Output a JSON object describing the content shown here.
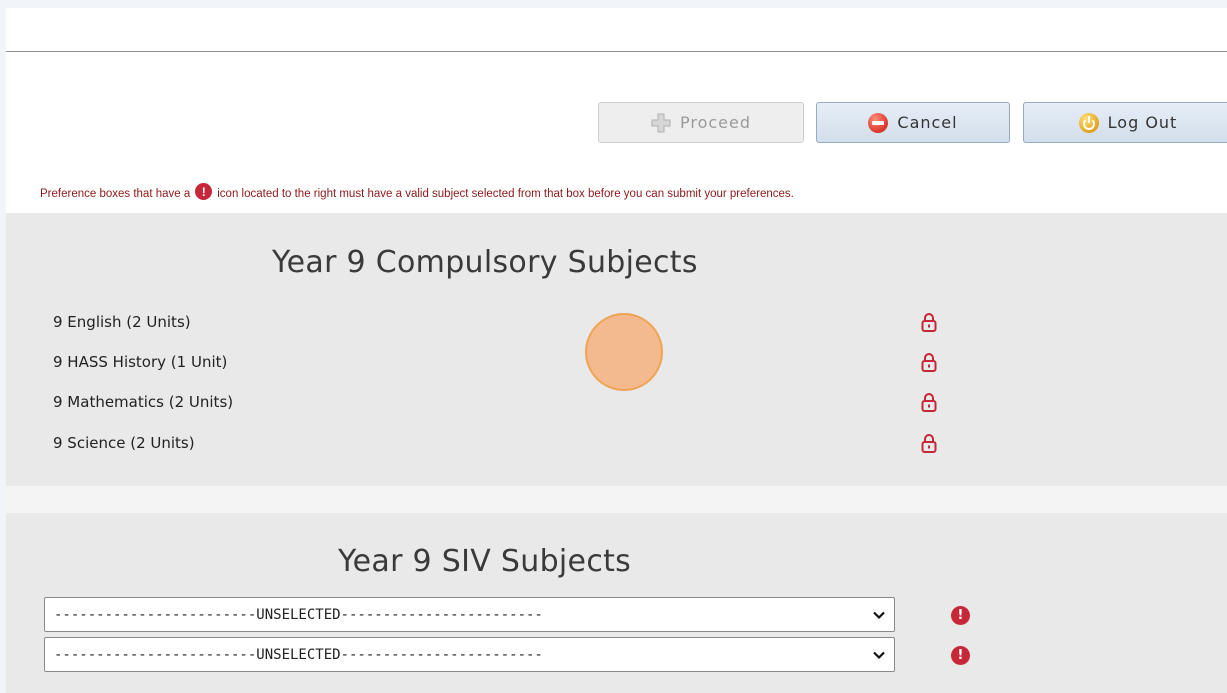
{
  "toolbar": {
    "proceed_label": "Proceed",
    "cancel_label": "Cancel",
    "logout_label": "Log Out"
  },
  "notice": {
    "text_before": "Preference boxes that have a",
    "icon_glyph": "!",
    "text_after": "icon located to the right must have a valid subject selected from that box before you can submit your preferences."
  },
  "compulsory": {
    "title": "Year 9 Compulsory Subjects",
    "subjects": [
      {
        "label": "9 English (2 Units)",
        "icon": "lock-icon"
      },
      {
        "label": "9 HASS History (1 Unit)",
        "icon": "lock-icon"
      },
      {
        "label": "9 Mathematics (2 Units)",
        "icon": "lock-icon"
      },
      {
        "label": "9 Science (2 Units)",
        "icon": "lock-icon"
      }
    ]
  },
  "siv": {
    "title": "Year 9 SIV Subjects",
    "selects": [
      {
        "value": "------------------------UNSELECTED------------------------",
        "icon": "warning-icon",
        "icon_glyph": "!"
      },
      {
        "value": "------------------------UNSELECTED------------------------",
        "icon": "warning-icon",
        "icon_glyph": "!"
      }
    ]
  },
  "colors": {
    "notice_text": "#8b1a1a",
    "warning": "#c6283a",
    "lock": "#c6283a",
    "section_bg": "#e9e9e9"
  }
}
